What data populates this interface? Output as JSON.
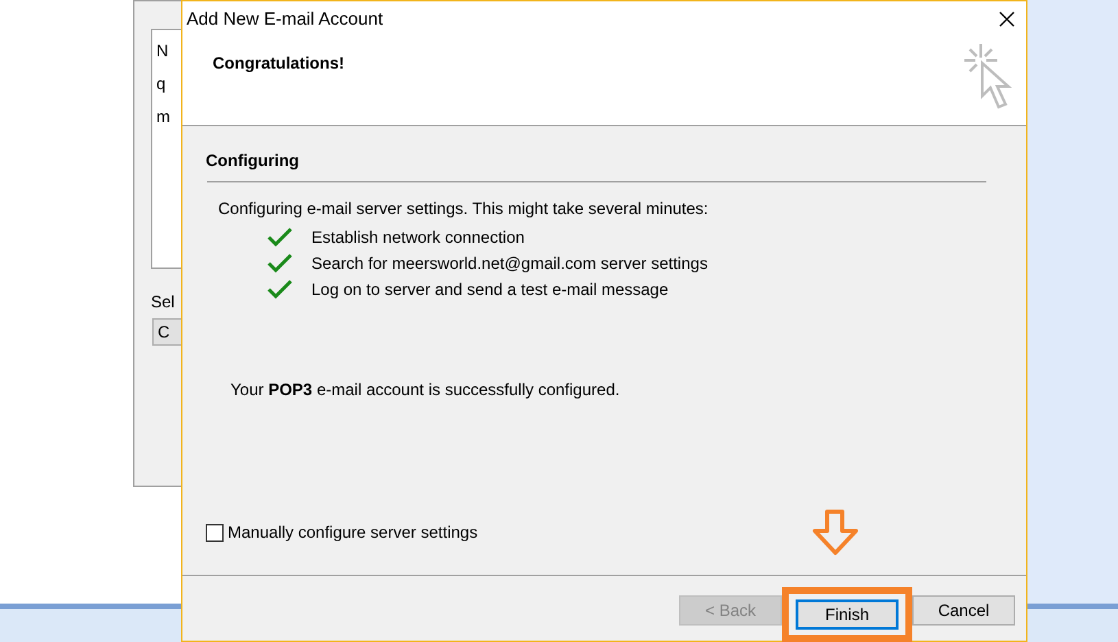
{
  "background_window": {
    "fragments": [
      "N",
      "q",
      "m"
    ],
    "label": "Sel",
    "button": "C"
  },
  "dialog": {
    "title": "Add New E-mail Account",
    "heading": "Congratulations!",
    "section_title": "Configuring",
    "intro": "Configuring e-mail server settings. This might take several minutes:",
    "steps": [
      {
        "label": "Establish network connection",
        "done": true
      },
      {
        "label": "Search for meersworld.net@gmail.com server settings",
        "done": true
      },
      {
        "label": "Log on to server and send a test e-mail message",
        "done": true
      }
    ],
    "result": "Your **POP3** e-mail account is successfully configured.",
    "manual_checkbox": {
      "label": "Manually configure server settings",
      "checked": false
    },
    "buttons": [
      {
        "label": "< Back",
        "disabled": true,
        "highlighted": false
      },
      {
        "label": "Finish",
        "disabled": false,
        "highlighted": true
      },
      {
        "label": "Cancel",
        "disabled": false,
        "highlighted": false
      }
    ]
  }
}
